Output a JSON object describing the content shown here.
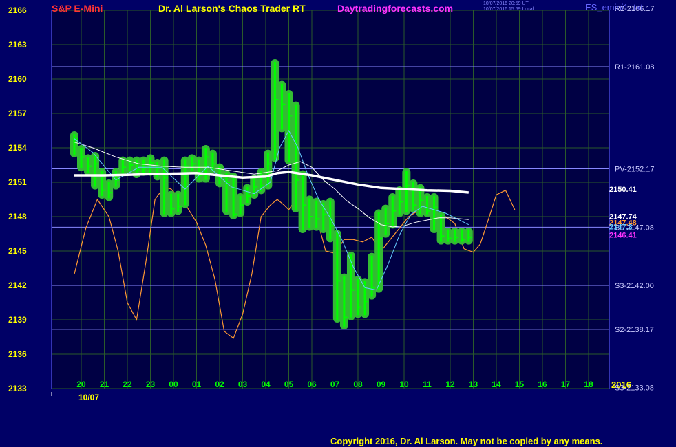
{
  "header": {
    "symbol": "S&P E-Mini",
    "title": "Dr. Al Larson's Chaos Trader RT",
    "site": "Daytradingforecasts.com",
    "time_line1": "10/07/2016 20:59 UT",
    "time_line2": "10/07/2016 15:59 Local",
    "chart_name": "ES_emini1..txt"
  },
  "copyright": "Copyright 2016, Dr. Al Larson. May not be copied by any means.",
  "colors": {
    "background": "#000066",
    "plot_background": "#000044",
    "grid": "#2a5a2a",
    "price_bars": "#00ff00",
    "price_glow": "#33bb33",
    "mean_line": "#ffffff",
    "forecast": "#ff9933",
    "pivot_lines": "#8888ff",
    "axis_labels": "#ffff00",
    "hour_labels": "#00ff00"
  },
  "chart_data": {
    "type": "line",
    "y_axis": {
      "ticks": [
        2166,
        2163,
        2160,
        2157,
        2154,
        2151,
        2148,
        2145,
        2142,
        2139,
        2136,
        2133
      ],
      "range": [
        2133,
        2166
      ]
    },
    "x_axis": {
      "hour_labels": [
        "20",
        "21",
        "22",
        "23",
        "00",
        "01",
        "02",
        "03",
        "04",
        "05",
        "06",
        "07",
        "08",
        "09",
        "10",
        "11",
        "12",
        "13",
        "14",
        "15",
        "16",
        "17",
        "18"
      ],
      "date_label": "10/07",
      "year_label": "2016",
      "range": [
        0,
        23.5
      ]
    },
    "pivot_levels": [
      {
        "label": "R2-2166.17",
        "value": 2166.17
      },
      {
        "label": "R1-2161.08",
        "value": 2161.08
      },
      {
        "label": "PV-2152.17",
        "value": 2152.17
      },
      {
        "label": "S1-2147.08",
        "value": 2147.08
      },
      {
        "label": "S3-2142.00",
        "value": 2142.0
      },
      {
        "label": "S2-2138.17",
        "value": 2138.17
      },
      {
        "label": "S3-2133.08",
        "value": 2133.08
      }
    ],
    "value_labels": [
      {
        "label": "2150.41",
        "value": 2150.41,
        "color": "#ffffff"
      },
      {
        "label": "2147.74",
        "value": 2147.74,
        "color": "#ffffff"
      },
      {
        "label": "2147.48",
        "value": 2147.5,
        "color": "#ff9933"
      },
      {
        "label": "2147.3",
        "value": 2147.3,
        "color": "#66ccff"
      },
      {
        "label": "2146.41",
        "value": 2146.41,
        "color": "#ff33ff"
      }
    ],
    "series": [
      {
        "type": "price",
        "x": [
          -0.3,
          0.0,
          0.3,
          0.6,
          0.9,
          1.2,
          1.5,
          1.8,
          2.1,
          2.4,
          2.7,
          3.0,
          3.3,
          3.6,
          3.9,
          4.2,
          4.5,
          4.8,
          5.1,
          5.4,
          5.7,
          6.0,
          6.3,
          6.6,
          6.9,
          7.2,
          7.5,
          7.8,
          8.1,
          8.4,
          8.7,
          9.0,
          9.3,
          9.6,
          9.9,
          10.2,
          10.5,
          10.8,
          11.1,
          11.4,
          11.7,
          12.0,
          12.3,
          12.6,
          12.9,
          13.2,
          13.5,
          13.8,
          14.1,
          14.4,
          14.7,
          15.0,
          15.3,
          15.6,
          15.9,
          16.2,
          16.5,
          16.8
        ],
        "close": [
          2154.8,
          2153.2,
          2152.4,
          2152.6,
          2150.3,
          2150.1,
          2151.2,
          2152.3,
          2152.5,
          2152.1,
          2152.2,
          2152.7,
          2152.2,
          2151.4,
          2148.7,
          2148.9,
          2152.4,
          2152.6,
          2151.6,
          2153.2,
          2152.6,
          2151.6,
          2151.0,
          2148.2,
          2149.0,
          2149.8,
          2150.6,
          2150.7,
          2152.6,
          2158.2,
          2157.8,
          2156.8,
          2151.2,
          2149.0,
          2148.0,
          2147.8,
          2148.2,
          2147.2,
          2142.4,
          2139.2,
          2141.6,
          2140.1,
          2140.6,
          2141.8,
          2146.1,
          2147.4,
          2148.5,
          2149.3,
          2150.7,
          2149.0,
          2149.4,
          2148.5,
          2148.8,
          2146.3,
          2146.1,
          2146.2,
          2146.0,
          2146.2
        ],
        "high": [
          2155.2,
          2154.0,
          2153.2,
          2153.4,
          2152.0,
          2151.0,
          2152.0,
          2153.0,
          2153.0,
          2153.0,
          2153.0,
          2153.2,
          2152.8,
          2153.0,
          2150.0,
          2150.0,
          2153.0,
          2153.2,
          2153.0,
          2154.0,
          2153.6,
          2152.4,
          2151.8,
          2151.6,
          2149.8,
          2150.6,
          2151.4,
          2152.0,
          2153.6,
          2161.5,
          2159.6,
          2158.8,
          2157.8,
          2151.8,
          2149.6,
          2149.4,
          2149.2,
          2149.4,
          2146.6,
          2142.8,
          2144.7,
          2142.6,
          2142.4,
          2144.6,
          2148.4,
          2148.8,
          2149.8,
          2150.4,
          2152.0,
          2151.0,
          2150.6,
          2149.8,
          2149.8,
          2148.2,
          2146.8,
          2146.8,
          2146.8,
          2146.8
        ],
        "low": [
          2153.4,
          2152.2,
          2151.8,
          2150.6,
          2149.8,
          2149.6,
          2150.6,
          2151.8,
          2152.0,
          2151.6,
          2151.8,
          2151.8,
          2151.4,
          2148.2,
          2148.2,
          2148.4,
          2149.0,
          2152.0,
          2151.2,
          2151.2,
          2152.0,
          2150.8,
          2148.4,
          2148.0,
          2148.2,
          2149.2,
          2149.8,
          2150.2,
          2150.6,
          2153.0,
          2155.6,
          2152.8,
          2148.6,
          2146.8,
          2147.0,
          2147.0,
          2146.8,
          2146.0,
          2139.0,
          2138.4,
          2139.2,
          2139.4,
          2139.4,
          2141.0,
          2141.6,
          2146.4,
          2147.2,
          2148.2,
          2148.4,
          2148.6,
          2148.2,
          2148.2,
          2146.8,
          2145.8,
          2145.8,
          2145.8,
          2145.8,
          2145.8
        ]
      },
      {
        "type": "mean",
        "x": [
          -0.3,
          1.0,
          2.0,
          3.0,
          4.0,
          5.0,
          6.0,
          7.0,
          8.0,
          8.5,
          9.0,
          10.0,
          11.0,
          12.0,
          13.0,
          14.0,
          15.0,
          16.0,
          16.8
        ],
        "y": [
          2151.6,
          2151.6,
          2151.65,
          2151.7,
          2151.75,
          2151.8,
          2151.6,
          2151.4,
          2151.5,
          2151.8,
          2151.9,
          2151.6,
          2151.2,
          2150.8,
          2150.5,
          2150.4,
          2150.3,
          2150.25,
          2150.1
        ]
      },
      {
        "type": "forecast",
        "x": [
          -0.3,
          0.2,
          0.7,
          1.2,
          1.6,
          2.0,
          2.4,
          2.8,
          3.2,
          3.6,
          3.9,
          4.3,
          4.6,
          5.0,
          5.4,
          5.8,
          6.2,
          6.6,
          7.0,
          7.4,
          7.8,
          8.2,
          8.5,
          8.8,
          9.0,
          9.3,
          9.6,
          9.9,
          10.2,
          10.6,
          11.0,
          11.4,
          11.8,
          12.2,
          12.6,
          13.0,
          13.4,
          13.8,
          14.2,
          14.6,
          15.0,
          15.4,
          15.8,
          16.2,
          16.6,
          17.0,
          17.3,
          17.6,
          18.0,
          18.4,
          18.8
        ],
        "y": [
          2143.0,
          2147.0,
          2149.5,
          2148.0,
          2145.0,
          2140.5,
          2139.0,
          2144.0,
          2149.5,
          2150.6,
          2150.4,
          2149.5,
          2148.8,
          2147.5,
          2145.5,
          2142.5,
          2138.0,
          2137.4,
          2139.5,
          2143.0,
          2148.0,
          2149.0,
          2149.5,
          2149.0,
          2148.6,
          2149.5,
          2150.0,
          2149.5,
          2148.0,
          2145.0,
          2144.8,
          2146.0,
          2146.0,
          2145.8,
          2146.2,
          2145.0,
          2146.0,
          2147.0,
          2148.0,
          2148.5,
          2148.5,
          2148.2,
          2148.0,
          2147.4,
          2145.2,
          2144.9,
          2145.6,
          2147.4,
          2149.9,
          2150.3,
          2148.6
        ]
      },
      {
        "type": "moving-average-slow",
        "x": [
          -0.3,
          0.5,
          1.5,
          2.5,
          3.5,
          4.5,
          5.5,
          6.5,
          7.5,
          8.5,
          9.0,
          9.5,
          10.0,
          10.5,
          11.0,
          11.5,
          12.0,
          12.5,
          13.0,
          13.5,
          14.0,
          14.5,
          15.0,
          15.5,
          16.0,
          16.8
        ],
        "y": [
          2154.5,
          2154.0,
          2153.2,
          2152.6,
          2152.4,
          2152.3,
          2152.3,
          2152.0,
          2151.7,
          2152.0,
          2152.5,
          2152.8,
          2152.3,
          2151.2,
          2150.4,
          2149.4,
          2148.7,
          2147.9,
          2147.3,
          2147.1,
          2147.2,
          2147.5,
          2147.7,
          2147.9,
          2147.9,
          2147.74
        ]
      },
      {
        "type": "moving-average-fast",
        "x": [
          -0.3,
          0.5,
          1.5,
          2.5,
          3.5,
          4.5,
          5.5,
          6.5,
          7.5,
          8.2,
          8.6,
          9.0,
          9.4,
          9.8,
          10.3,
          10.8,
          11.3,
          11.8,
          12.3,
          12.8,
          13.3,
          13.8,
          14.3,
          14.8,
          15.3,
          15.8,
          16.3,
          16.8
        ],
        "y": [
          2154.8,
          2153.6,
          2151.2,
          2152.3,
          2152.3,
          2150.4,
          2152.4,
          2150.6,
          2150.0,
          2151.0,
          2154.0,
          2155.5,
          2154.0,
          2151.8,
          2149.5,
          2147.9,
          2146.0,
          2143.6,
          2141.8,
          2141.6,
          2143.8,
          2146.4,
          2148.2,
          2148.9,
          2148.6,
          2148.3,
          2147.8,
          2147.3
        ]
      }
    ]
  }
}
